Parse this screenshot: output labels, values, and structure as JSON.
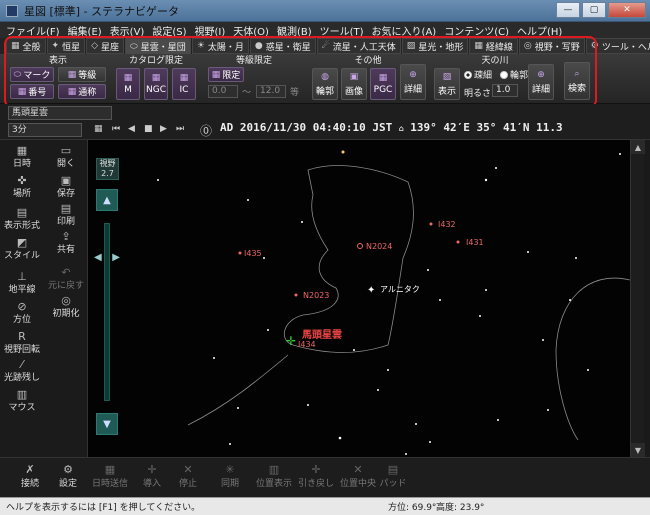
{
  "window": {
    "title": "星図 [標準] - ステラナビゲータ",
    "minimize": "—",
    "maximize": "▢",
    "close": "✕"
  },
  "menu": [
    "ファイル(F)",
    "編集(E)",
    "表示(V)",
    "設定(S)",
    "視野(I)",
    "天体(O)",
    "観測(B)",
    "ツール(T)",
    "お気に入り(A)",
    "コンテンツ(C)",
    "ヘルプ(H)"
  ],
  "tabs": [
    {
      "icon": "▦",
      "label": "全般"
    },
    {
      "icon": "✦",
      "label": "恒星"
    },
    {
      "icon": "◇",
      "label": "星座"
    },
    {
      "icon": "⬭",
      "label": "星雲・星団"
    },
    {
      "icon": "☀",
      "label": "太陽・月"
    },
    {
      "icon": "●",
      "label": "惑星・衛星"
    },
    {
      "icon": "☄",
      "label": "流星・人工天体"
    },
    {
      "icon": "▨",
      "label": "星光・地形"
    },
    {
      "icon": "▦",
      "label": "経緯線"
    },
    {
      "icon": "◎",
      "label": "視野・写野"
    },
    {
      "icon": "⚙",
      "label": "ツール・ヘルプ"
    }
  ],
  "ribbon": {
    "display_group": "表示",
    "mark": "マーク",
    "magnitude": "等級",
    "number": "番号",
    "common_name": "通称",
    "catalog_group": "カタログ限定",
    "cat_m": "M",
    "cat_ngc": "NGC",
    "cat_ic": "IC",
    "mag_limit_group": "等級限定",
    "limit": "限定",
    "mag_min": "0.0",
    "mag_max": "12.0",
    "range_sep": "〜",
    "unit": "等",
    "other_group": "その他",
    "outline": "輪郭",
    "image": "画像",
    "pgc": "PGC",
    "detail1": "詳細",
    "milkyway_group": "天の川",
    "show": "表示",
    "sparse": "疎細",
    "outline_radio": "輪郭",
    "brightness_label": "明るさ:",
    "brightness": "1.0",
    "detail2": "詳細",
    "search": "検索"
  },
  "toolbar2": {
    "object_select": "馬頭星雲",
    "interval": "3分",
    "datetime": "AD 2016/11/30 04:40:10 JST",
    "coords": "139° 42′E 35° 41′N 11.3"
  },
  "left_panel": [
    "日時",
    "開く",
    "場所",
    "保存",
    "表示形式",
    "印刷",
    "スタイル",
    "共有",
    "地平線",
    "元に戻す",
    "方位",
    "初期化",
    "視野回転",
    "光跡残し",
    "マウス"
  ],
  "fov": {
    "label": "視野",
    "value": "2.7"
  },
  "sky_labels": {
    "i432": "I432",
    "i431": "I431",
    "n2024": "N2024",
    "i435": "I435",
    "n2023": "N2023",
    "alnitak": "アルニタク",
    "horsehead": "馬頭星雲",
    "i434": "I434"
  },
  "bottom": [
    "接続",
    "設定",
    "日時送信",
    "導入",
    "停止",
    "同期",
    "位置表示",
    "引き戻し",
    "位置中央",
    "パッド"
  ],
  "status": {
    "help": "ヘルプを表示するには [F1] を押してください。",
    "azimuth": "方位: 69.9°",
    "altitude": "高度: 23.9°"
  }
}
